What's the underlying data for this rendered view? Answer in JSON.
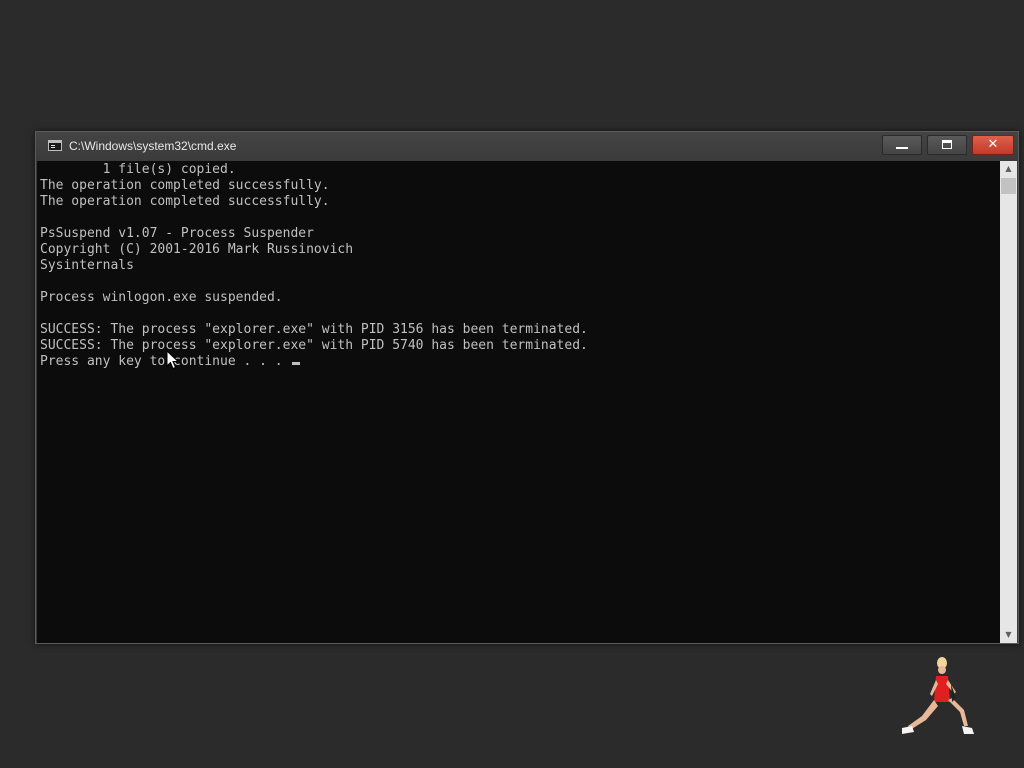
{
  "window": {
    "title": "C:\\Windows\\system32\\cmd.exe",
    "close_glyph": "✕"
  },
  "console": {
    "lines": [
      "        1 file(s) copied.",
      "The operation completed successfully.",
      "The operation completed successfully.",
      "",
      "PsSuspend v1.07 - Process Suspender",
      "Copyright (C) 2001-2016 Mark Russinovich",
      "Sysinternals",
      "",
      "Process winlogon.exe suspended.",
      "",
      "SUCCESS: The process \"explorer.exe\" with PID 3156 has been terminated.",
      "SUCCESS: The process \"explorer.exe\" with PID 5740 has been terminated.",
      "Press any key to continue . . . "
    ]
  },
  "scrollbar": {
    "up_arrow": "▲",
    "down_arrow": "▼"
  },
  "icons": {
    "app": "cmd-console-icon",
    "minimize": "minimize-icon",
    "maximize": "maximize-icon",
    "close": "close-icon",
    "pointer": "mouse-pointer-icon",
    "desktop_figure": "animated-dancer-figure"
  },
  "colors": {
    "desktop": "#2b2b2b",
    "titlebar": "#3b3b3b",
    "console_bg": "#0c0c0c",
    "console_text": "#c0c0c0",
    "close_button": "#c8412f"
  }
}
